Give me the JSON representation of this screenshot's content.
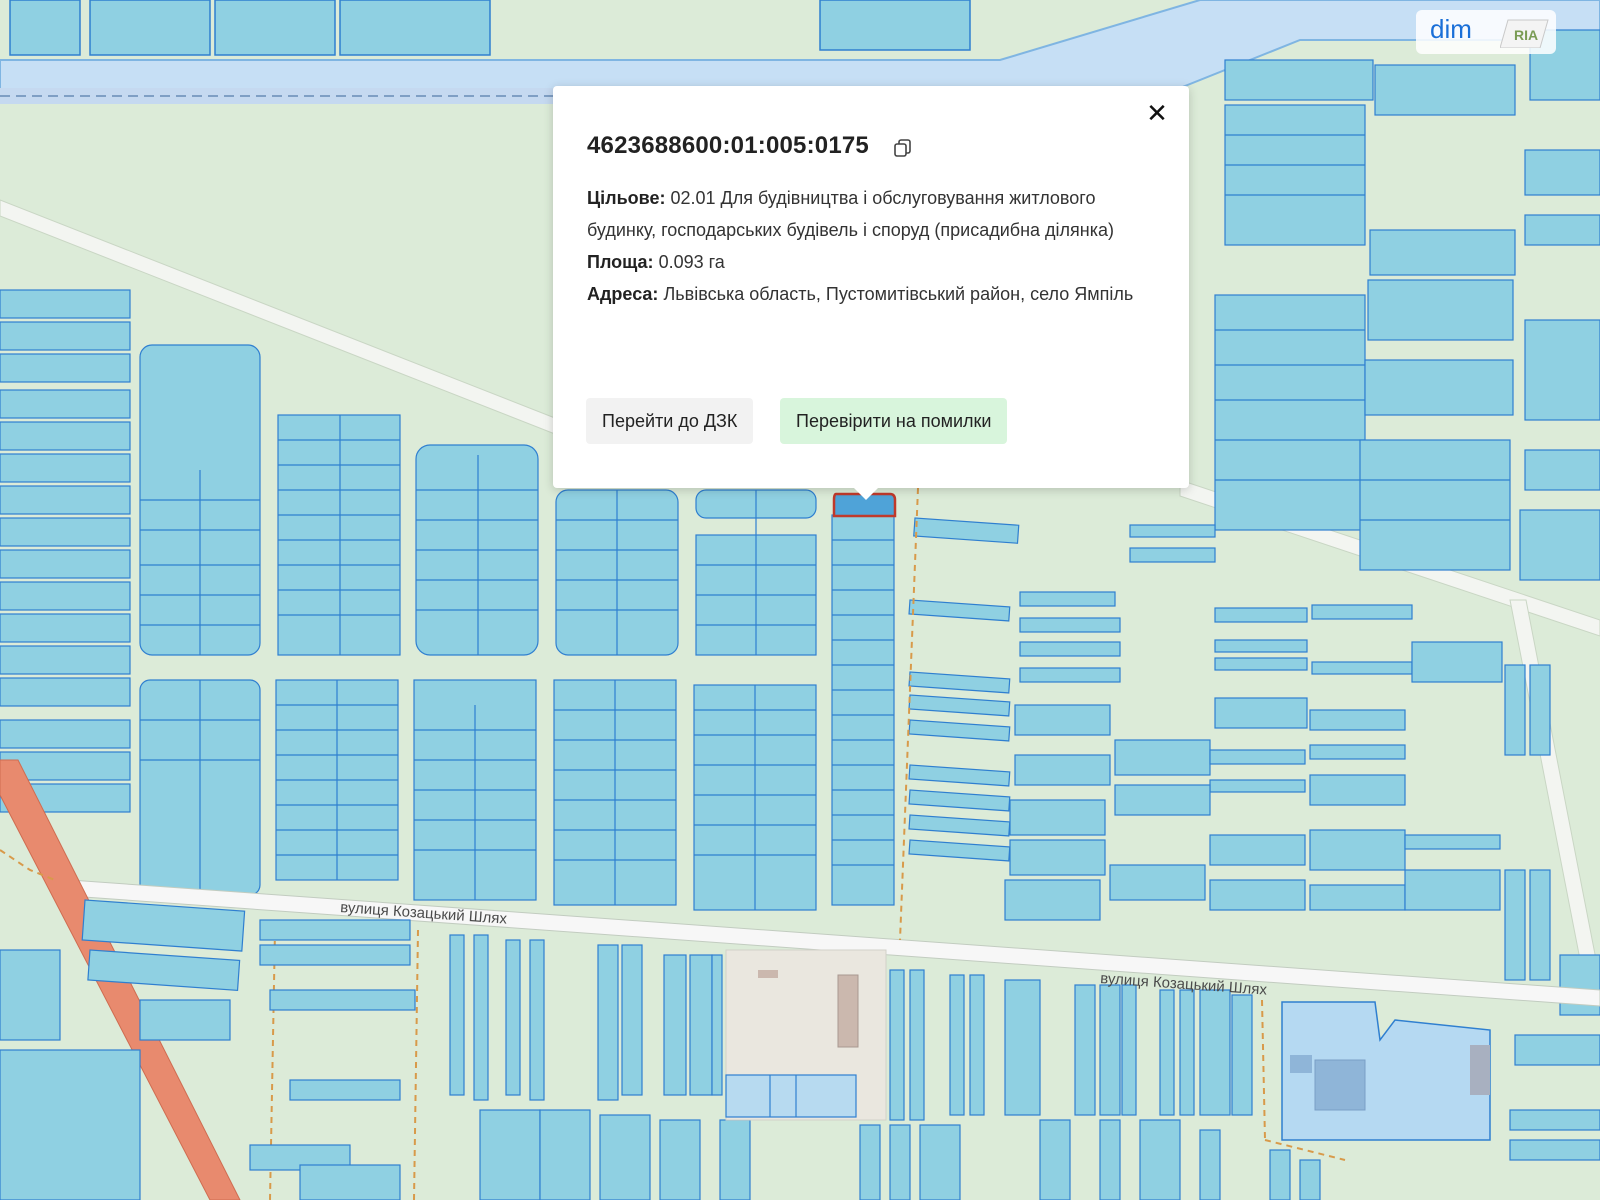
{
  "map": {
    "street_labels": [
      "вулиця Козацький Шлях",
      "вулиця Козацький Шлях"
    ],
    "colors": {
      "background": "#dcebd8",
      "parcel_fill": "#8fd0e2",
      "parcel_stroke": "#2f7fd0",
      "selected_fill": "#4fa3d8",
      "selected_stroke": "#c0392b",
      "road": "#f7f7f7",
      "main_road": "#e88a6e",
      "river": "#c6dff5",
      "boundary_dash": "#d89a4a"
    }
  },
  "popup": {
    "parcel_id": "4623688600:01:005:0175",
    "purpose_label": "Цільове:",
    "purpose_value": "02.01 Для будівництва і обслуговування житлового будинку, господарських будівель і споруд (присадибна ділянка)",
    "area_label": "Площа:",
    "area_value": "0.093 га",
    "address_label": "Адреса:",
    "address_value": "Львівська область, Пустомитівський район, село Ямпіль",
    "button_dzk": "Перейти до ДЗК",
    "button_check": "Перевірити на помилки",
    "close_icon": "close-icon",
    "copy_icon": "copy-icon"
  },
  "logo": {
    "text": "dim",
    "badge": "RIA"
  }
}
